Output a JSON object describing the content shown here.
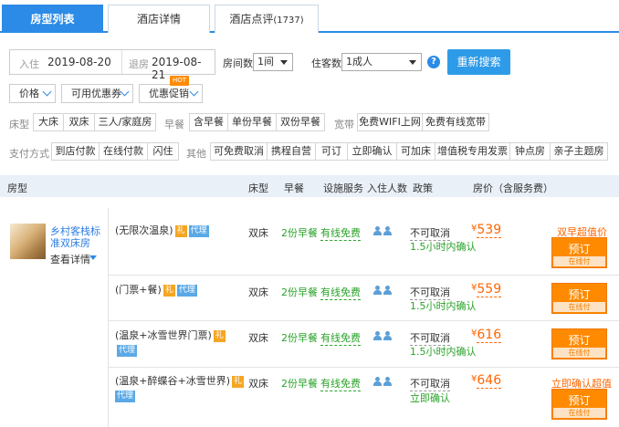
{
  "tabs": [
    {
      "label": "房型列表"
    },
    {
      "label": "酒店详情"
    },
    {
      "label": "酒店点评",
      "count": "(1737)"
    }
  ],
  "search": {
    "checkin_label": "入住",
    "checkin_date": "2019-08-20",
    "checkout_label": "退房",
    "checkout_date": "2019-08-21",
    "rooms_label": "房间数",
    "rooms_value": "1间",
    "guests_label": "住客数",
    "guests_value": "1成人",
    "help_icon": "?",
    "button": "重新搜索"
  },
  "filters": {
    "price": "价格",
    "coupon": "可用优惠券",
    "promo": "优惠促销",
    "hot_badge": "HOT"
  },
  "bed_row": {
    "label": "床型",
    "options": [
      "大床",
      "双床",
      "三人/家庭房"
    ]
  },
  "breakfast_row": {
    "label": "早餐",
    "options": [
      "含早餐",
      "单份早餐",
      "双份早餐"
    ]
  },
  "broadband_row": {
    "label": "宽带",
    "options": [
      "免费WIFI上网",
      "免费有线宽带"
    ]
  },
  "payment_row": {
    "label": "支付方式",
    "options": [
      "到店付款",
      "在线付款",
      "闪住"
    ]
  },
  "other_row": {
    "label": "其他",
    "options": [
      "可免费取消",
      "携程自营",
      "可订",
      "立即确认",
      "可加床",
      "增值税专用发票",
      "钟点房",
      "亲子主题房"
    ]
  },
  "table_header": {
    "room_type": "房型",
    "bed": "床型",
    "breakfast": "早餐",
    "facilities": "设施服务",
    "occupancy": "入住人数",
    "policy": "政策",
    "price": "房价（含服务费）"
  },
  "hotel_room": {
    "name": "乡村客栈标准双床房",
    "detail_link": "查看详情"
  },
  "offers": [
    {
      "name": "(无限次温泉)",
      "tag_gift": "礼",
      "tag_agent": "代理",
      "bed": "双床",
      "breakfast": "2份早餐",
      "broadband": "有线免费",
      "policy": "不可取消",
      "confirm": "1.5小时内确认",
      "price": "539",
      "currency": "¥",
      "promo": "双早超值价",
      "book": "预订",
      "pay": "在线付"
    },
    {
      "name": "(门票+餐)",
      "tag_gift": "礼",
      "tag_agent": "代理",
      "bed": "双床",
      "breakfast": "2份早餐",
      "broadband": "有线免费",
      "policy": "不可取消",
      "confirm": "1.5小时内确认",
      "price": "559",
      "currency": "¥",
      "promo": "",
      "book": "预订",
      "pay": "在线付"
    },
    {
      "name": "(温泉+冰雪世界门票)",
      "tag_gift": "礼",
      "tag_agent": "代理",
      "bed": "双床",
      "breakfast": "2份早餐",
      "broadband": "有线免费",
      "policy": "不可取消",
      "confirm": "1.5小时内确认",
      "price": "616",
      "currency": "¥",
      "promo": "",
      "book": "预订",
      "pay": "在线付"
    },
    {
      "name": "(温泉+醉蝶谷+冰雪世界)",
      "tag_gift": "礼",
      "tag_agent": "代理",
      "bed": "双床",
      "breakfast": "2份早餐",
      "broadband": "有线免费",
      "policy": "不可取消",
      "confirm": "立即确认",
      "price": "646",
      "currency": "¥",
      "promo": "立即确认超值价",
      "book": "预订",
      "pay": "在线付"
    }
  ],
  "colors": {
    "accent": "#2b8be6",
    "price": "#ff6600",
    "book": "#ff8a00",
    "green": "#2aa32a"
  }
}
